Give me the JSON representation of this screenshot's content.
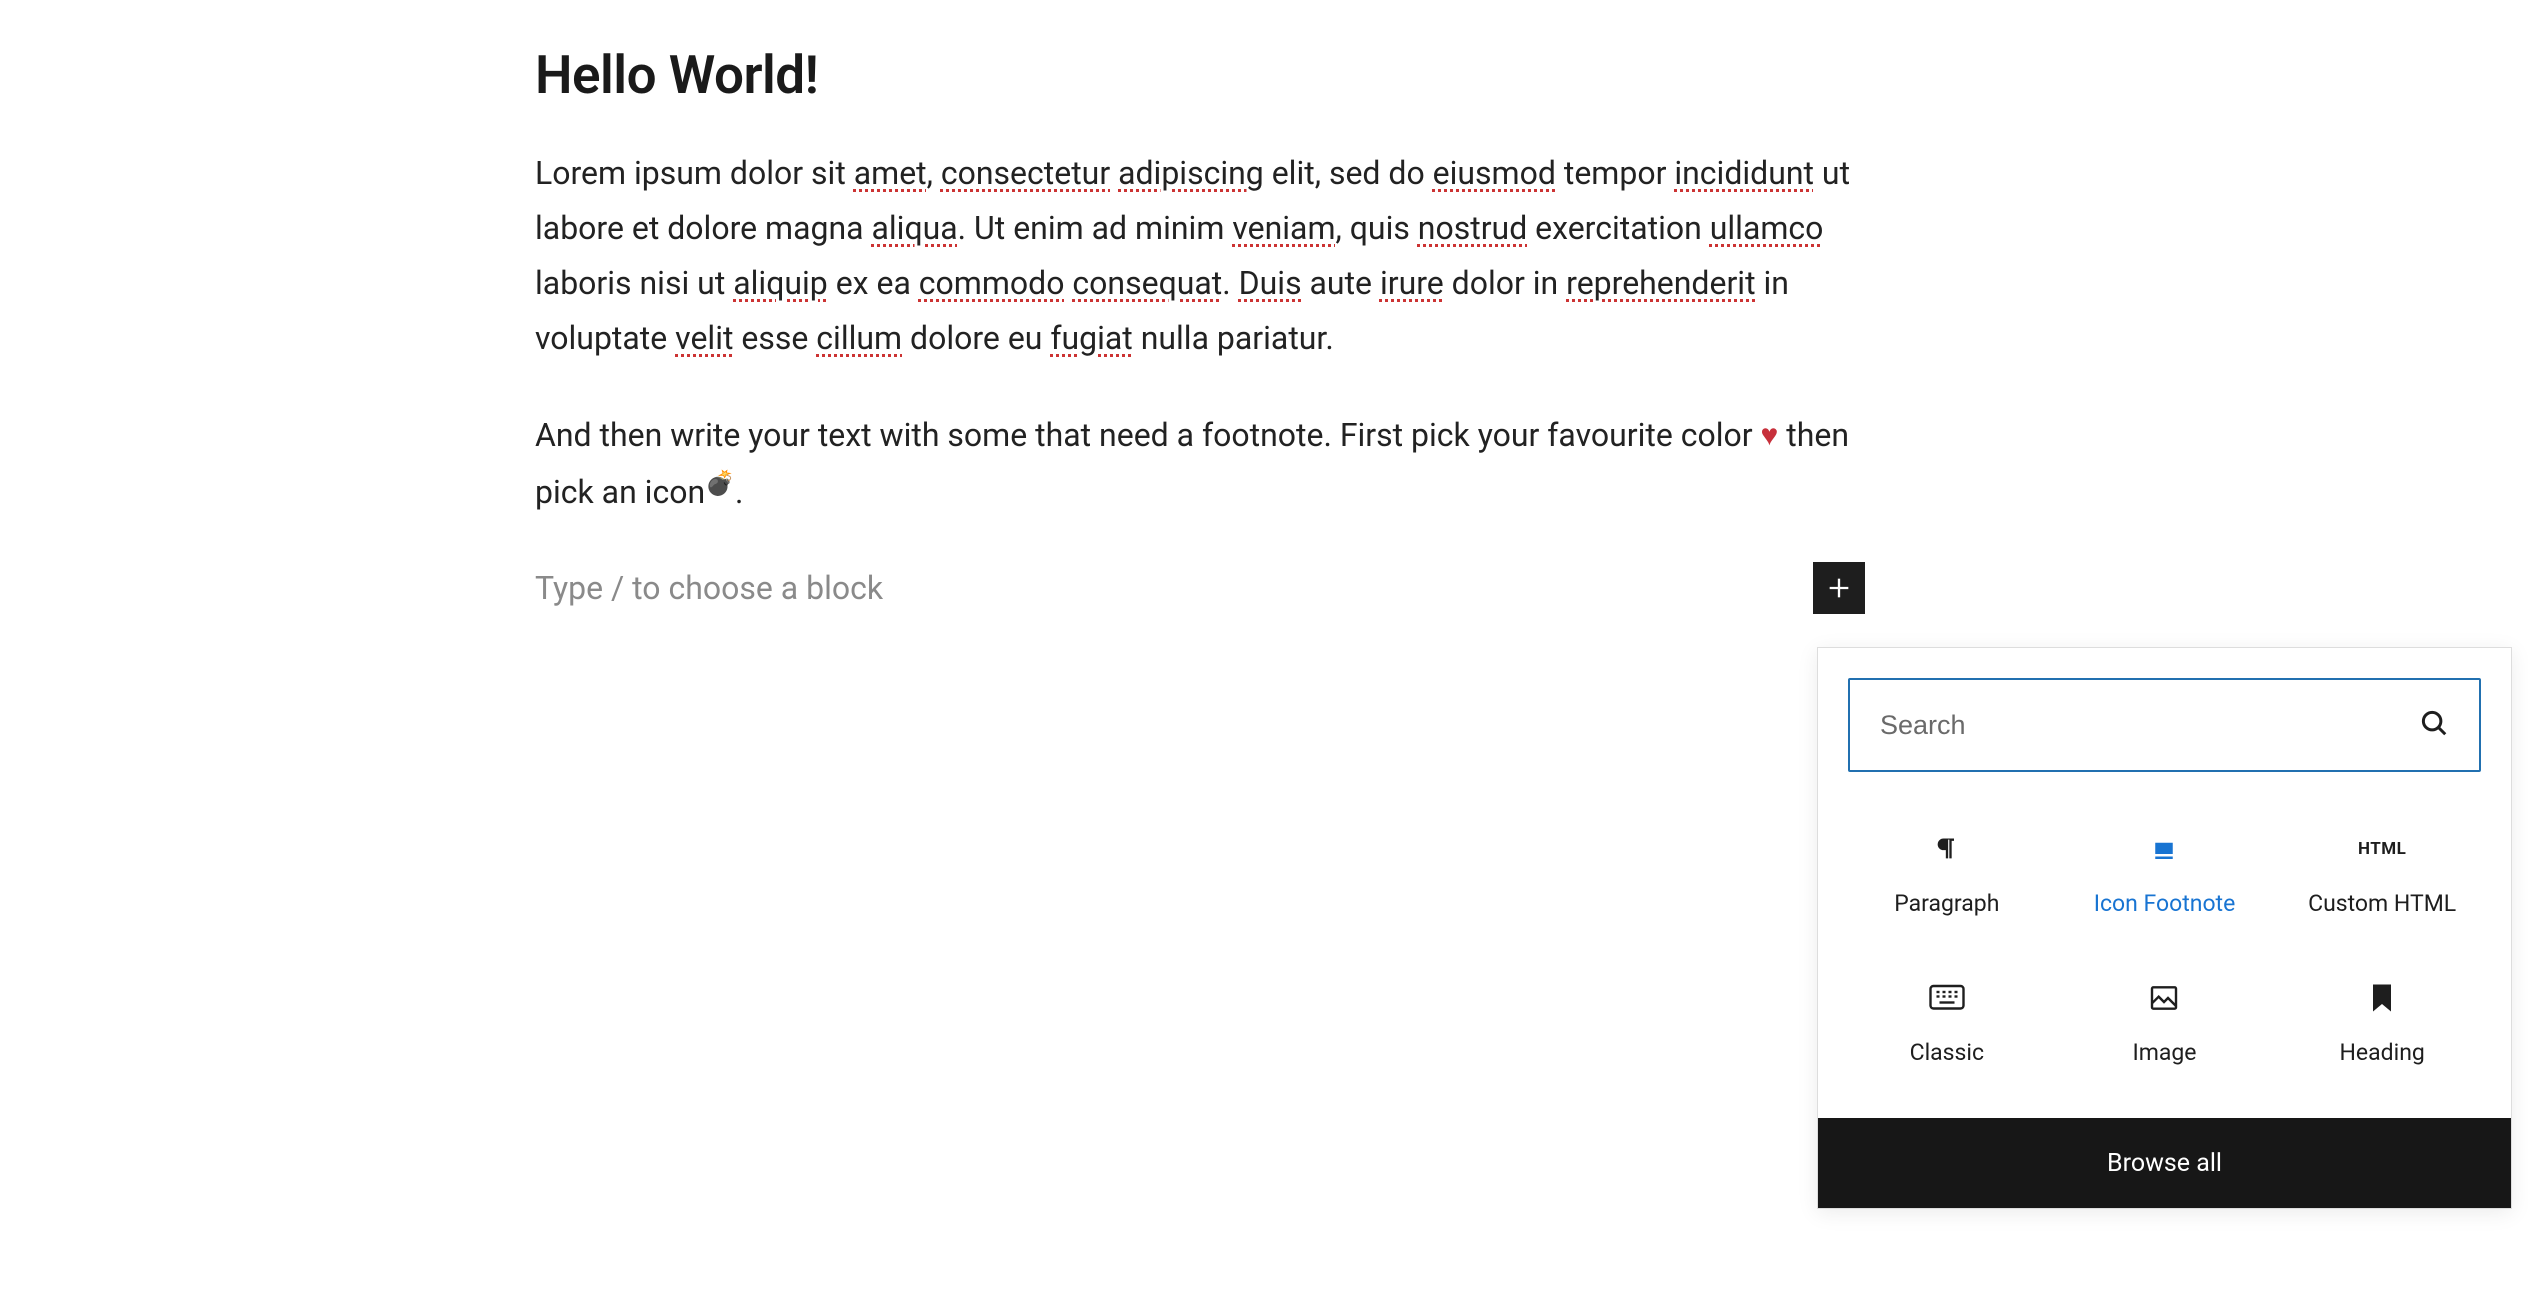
{
  "title": "Hello World!",
  "paragraph1": {
    "segments": [
      {
        "t": "Lorem ipsum dolor sit ",
        "sp": false
      },
      {
        "t": "amet",
        "sp": true
      },
      {
        "t": ", ",
        "sp": false
      },
      {
        "t": "consectetur",
        "sp": true
      },
      {
        "t": " ",
        "sp": false
      },
      {
        "t": "adipiscing",
        "sp": true
      },
      {
        "t": " elit, sed do ",
        "sp": false
      },
      {
        "t": "eiusmod",
        "sp": true
      },
      {
        "t": " tempor ",
        "sp": false
      },
      {
        "t": "incididunt",
        "sp": true
      },
      {
        "t": " ut labore et dolore magna ",
        "sp": false
      },
      {
        "t": "aliqua",
        "sp": true
      },
      {
        "t": ". Ut enim ad minim ",
        "sp": false
      },
      {
        "t": "veniam",
        "sp": true
      },
      {
        "t": ", quis ",
        "sp": false
      },
      {
        "t": "nostrud",
        "sp": true
      },
      {
        "t": " exercitation ",
        "sp": false
      },
      {
        "t": "ullamco",
        "sp": true
      },
      {
        "t": " laboris nisi ut ",
        "sp": false
      },
      {
        "t": "aliquip",
        "sp": true
      },
      {
        "t": " ex ea ",
        "sp": false
      },
      {
        "t": "commodo",
        "sp": true
      },
      {
        "t": " ",
        "sp": false
      },
      {
        "t": "consequat",
        "sp": true
      },
      {
        "t": ". ",
        "sp": false
      },
      {
        "t": "Duis",
        "sp": true
      },
      {
        "t": " aute ",
        "sp": false
      },
      {
        "t": "irure",
        "sp": true
      },
      {
        "t": " dolor in ",
        "sp": false
      },
      {
        "t": "reprehenderit",
        "sp": true
      },
      {
        "t": " in voluptate ",
        "sp": false
      },
      {
        "t": "velit",
        "sp": true
      },
      {
        "t": " esse ",
        "sp": false
      },
      {
        "t": "cillum",
        "sp": true
      },
      {
        "t": " dolore eu ",
        "sp": false
      },
      {
        "t": "fugiat",
        "sp": true
      },
      {
        "t": " nulla pariatur.",
        "sp": false
      }
    ]
  },
  "paragraph2": {
    "pre_heart": "And then write your text with some that need a footnote. First pick your favourite color ",
    "heart": "♥",
    "mid": " then pick an icon",
    "bomb": "💣",
    "post": "."
  },
  "new_block_placeholder": "Type / to choose a block",
  "inserter": {
    "search_placeholder": "Search",
    "blocks": [
      {
        "id": "paragraph",
        "label": "Paragraph",
        "icon": "pilcrow",
        "highlight": false
      },
      {
        "id": "icon-footnote",
        "label": "Icon Footnote",
        "icon": "footnote",
        "highlight": true
      },
      {
        "id": "custom-html",
        "label": "Custom HTML",
        "icon": "html",
        "highlight": false
      },
      {
        "id": "classic",
        "label": "Classic",
        "icon": "keyboard",
        "highlight": false
      },
      {
        "id": "image",
        "label": "Image",
        "icon": "image",
        "highlight": false
      },
      {
        "id": "heading",
        "label": "Heading",
        "icon": "bookmark",
        "highlight": false
      }
    ],
    "browse_all": "Browse all"
  }
}
